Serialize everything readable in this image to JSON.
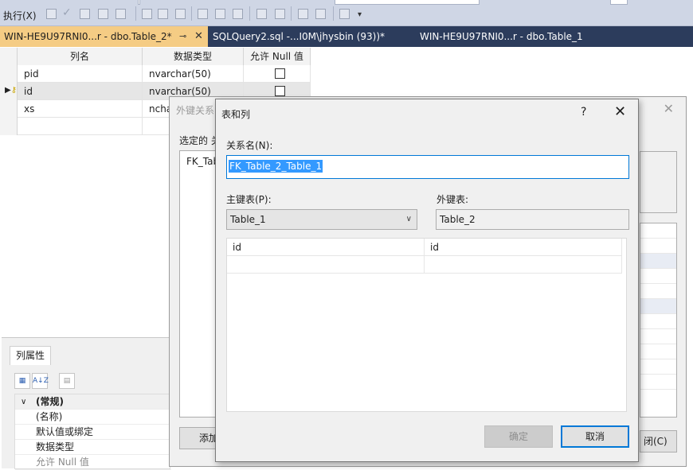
{
  "toolbar": {
    "execute_label": "执行(X)"
  },
  "tabs": [
    {
      "label": "WIN-HE9U97RNI0...r - dbo.Table_2*",
      "active": true
    },
    {
      "label": "SQLQuery2.sql -...I0M\\jhysbin (93))*",
      "active": false
    },
    {
      "label": "WIN-HE9U97RNI0...r - dbo.Table_1",
      "active": false
    }
  ],
  "designer": {
    "headers": [
      "列名",
      "数据类型",
      "允许 Null 值"
    ],
    "rows": [
      {
        "name": "pid",
        "type": "nvarchar(50)",
        "allow_null": false
      },
      {
        "name": "id",
        "type": "nvarchar(50)",
        "allow_null": false
      },
      {
        "name": "xs",
        "type": "ncha",
        "allow_null": false
      }
    ]
  },
  "column_properties": {
    "tab_label": "列属性",
    "sort_icon_text": "A↓Z",
    "category": "(常规)",
    "items": [
      "(名称)",
      "默认值或绑定",
      "数据类型",
      "允许 Null 值"
    ]
  },
  "fk_dialog": {
    "title": "外键关系",
    "selected_label": "选定的 关",
    "list_item": "FK_Tab",
    "add_button": "添加",
    "close_button": "闭(C)"
  },
  "tables_columns_dialog": {
    "title": "表和列",
    "help_glyph": "?",
    "close_glyph": "✕",
    "relation_name_label": "关系名(N):",
    "relation_name_value": "FK_Table_2_Table_1",
    "pk_table_label": "主键表(P):",
    "pk_table_value": "Table_1",
    "fk_table_label": "外键表:",
    "fk_table_value": "Table_2",
    "columns": [
      {
        "pk_column": "id",
        "fk_column": "id"
      },
      {
        "pk_column": "",
        "fk_column": ""
      }
    ],
    "ok_button": "确定",
    "cancel_button": "取消"
  },
  "colors": {
    "toolbar_bg": "#cfd6e5",
    "tab_strip_bg": "#2c3c5c",
    "active_tab_bg": "#f5cc84",
    "selection_blue": "#3399ff",
    "focus_border": "#0078d7"
  }
}
